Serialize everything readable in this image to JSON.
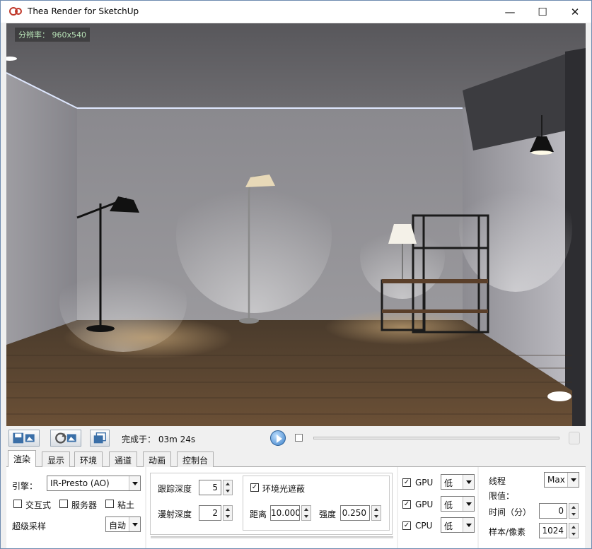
{
  "window": {
    "title": "Thea Render for SketchUp",
    "min_icon": "minimize-icon",
    "max_icon": "maximize-icon",
    "close_icon": "close-icon"
  },
  "viewport": {
    "resolution_label": "分辨率：  960x540"
  },
  "toolbar": {
    "done_label": "完成于：  03m 24s",
    "save_icon": "save-image-icon",
    "refresh_icon": "refresh-render-icon",
    "copy_icon": "copy-image-icon",
    "play_icon": "play-icon"
  },
  "tabs": [
    {
      "label": "渲染",
      "active": true
    },
    {
      "label": "显示"
    },
    {
      "label": "环境"
    },
    {
      "label": "通道"
    },
    {
      "label": "动画"
    },
    {
      "label": "控制台"
    }
  ],
  "render": {
    "engine_label": "引擎：",
    "engine_value": "IR-Presto (AO)",
    "interactive_label": "交互式",
    "server_label": "服务器",
    "clay_label": "粘土",
    "supersampling_label": "超级采样",
    "supersampling_value": "自动",
    "trace_depth_label": "跟踪深度",
    "trace_depth_value": "5",
    "diffuse_depth_label": "漫射深度",
    "diffuse_depth_value": "2",
    "ao_label": "环境光遮蔽",
    "ao_checked": true,
    "distance_label": "距离",
    "distance_value": "10.000",
    "intensity_label": "强度",
    "intensity_value": "0.250",
    "devices": [
      {
        "label": "GPU",
        "checked": true,
        "priority": "低"
      },
      {
        "label": "GPU",
        "checked": true,
        "priority": "低"
      },
      {
        "label": "CPU",
        "checked": true,
        "priority": "低"
      }
    ],
    "threads_label": "线程",
    "threads_value": "Max",
    "limit_label": "限值：",
    "time_label": "时间（分）",
    "time_value": "0",
    "samples_label": "样本/像素",
    "samples_value": "1024"
  }
}
